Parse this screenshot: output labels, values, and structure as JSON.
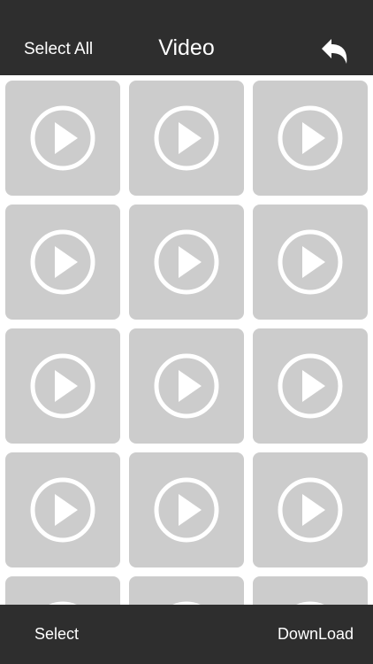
{
  "header": {
    "select_all_label": "Select All",
    "title": "Video",
    "back_icon": "undo-arrow-icon"
  },
  "grid": {
    "tile_icon": "play-circle-icon",
    "tile_color": "#cccccc",
    "tiles": [
      {
        "id": 1
      },
      {
        "id": 2
      },
      {
        "id": 3
      },
      {
        "id": 4
      },
      {
        "id": 5
      },
      {
        "id": 6
      },
      {
        "id": 7
      },
      {
        "id": 8
      },
      {
        "id": 9
      },
      {
        "id": 10
      },
      {
        "id": 11
      },
      {
        "id": 12
      },
      {
        "id": 13
      },
      {
        "id": 14
      },
      {
        "id": 15
      }
    ]
  },
  "footer": {
    "select_label": "Select",
    "download_label": "DownLoad"
  },
  "colors": {
    "bar_background": "#2e2e2e",
    "tile_background": "#cccccc",
    "icon_color": "#ffffff"
  }
}
